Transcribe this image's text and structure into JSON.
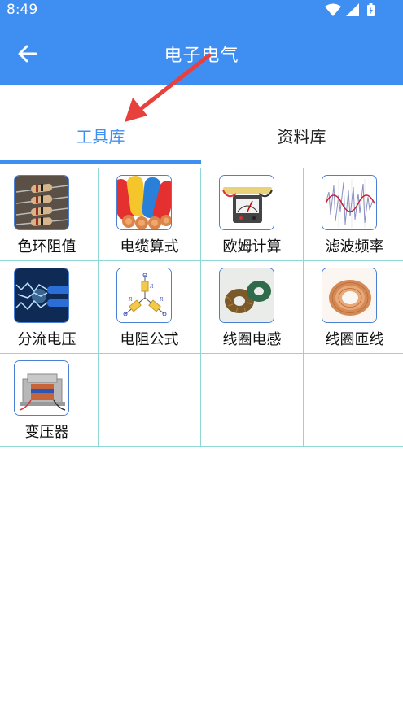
{
  "status_bar": {
    "time": "8:49",
    "icons": [
      "wifi-icon",
      "signal-icon",
      "battery-charging-icon"
    ]
  },
  "app_bar": {
    "title": "电子电气",
    "back_icon": "back-arrow-icon"
  },
  "tabs": [
    {
      "label": "工具库",
      "selected": true
    },
    {
      "label": "资料库",
      "selected": false
    }
  ],
  "tools": [
    {
      "label": "色环阻值",
      "icon": "resistor-icon"
    },
    {
      "label": "电缆算式",
      "icon": "cable-icon"
    },
    {
      "label": "欧姆计算",
      "icon": "ohmmeter-icon"
    },
    {
      "label": "滤波频率",
      "icon": "waveform-icon"
    },
    {
      "label": "分流电压",
      "icon": "electric-arc-icon"
    },
    {
      "label": "电阻公式",
      "icon": "resistor-network-icon"
    },
    {
      "label": "线圈电感",
      "icon": "toroid-coil-icon"
    },
    {
      "label": "线圈匝线",
      "icon": "copper-coil-icon"
    },
    {
      "label": "变压器",
      "icon": "transformer-icon"
    }
  ],
  "colors": {
    "primary": "#3f8ff2",
    "grid_line": "#8fd6d6",
    "annotation_arrow": "#e8403c"
  }
}
